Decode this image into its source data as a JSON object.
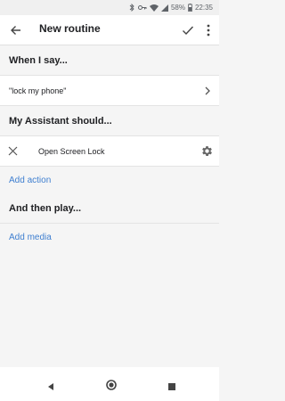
{
  "status": {
    "battery": "58%",
    "time": "22:35"
  },
  "app_bar": {
    "title": "New routine"
  },
  "trigger": {
    "header": "When I say...",
    "phrase": "\"lock my phone\""
  },
  "actions": {
    "header": "My Assistant should...",
    "items": [
      {
        "label": "Open Screen Lock"
      }
    ],
    "add_label": "Add action"
  },
  "media": {
    "header": "And then play...",
    "add_label": "Add media"
  },
  "colors": {
    "accent": "#3f7fd0",
    "background": "#f5f5f5",
    "surface": "#ffffff"
  }
}
